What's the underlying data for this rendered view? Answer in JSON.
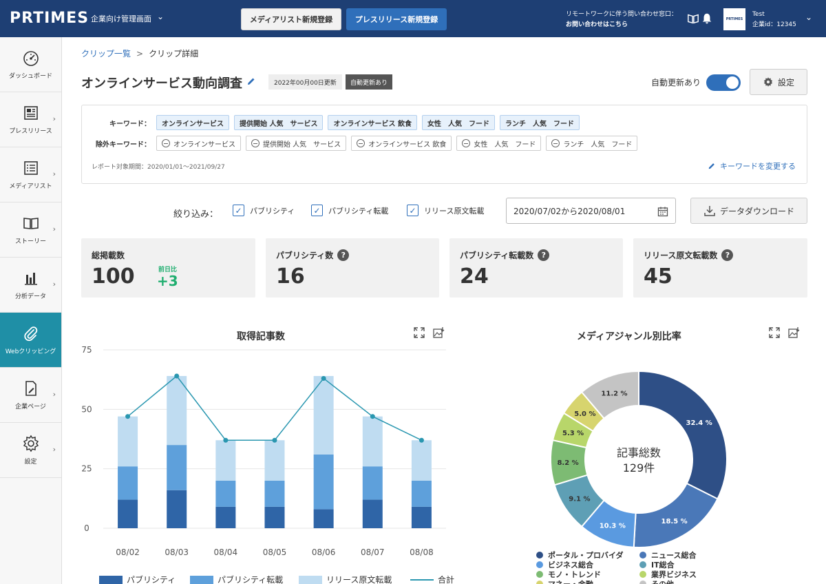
{
  "topbar": {
    "logo": "PRTIMES",
    "subtitle": "企業向け管理画面",
    "media_btn": "メディアリスト新規登録",
    "press_btn": "プレスリリース新規登録",
    "remote_line1": "リモートワークに伴う問い合わせ窓口：",
    "remote_line2": "お問い合わせはこちら",
    "avatar_text": "PRTIMES",
    "user_name": "Test",
    "user_id": "企業id：12345"
  },
  "sidebar": {
    "items": [
      {
        "label": "ダッシュボード",
        "icon": "gauge-icon"
      },
      {
        "label": "プレスリリース",
        "icon": "newspaper-icon"
      },
      {
        "label": "メディアリスト",
        "icon": "list-icon"
      },
      {
        "label": "ストーリー",
        "icon": "book-icon"
      },
      {
        "label": "分析データ",
        "icon": "bar-chart-icon"
      },
      {
        "label": "Webクリッピング",
        "icon": "paperclip-icon"
      },
      {
        "label": "企業ページ",
        "icon": "edit-page-icon"
      },
      {
        "label": "設定",
        "icon": "gear-icon"
      }
    ]
  },
  "breadcrumb": {
    "parent": "クリップ一覧",
    "sep": ">",
    "current": "クリップ詳細"
  },
  "header": {
    "title": "オンラインサービス動向調査",
    "updated": "2022年00月00日更新",
    "auto_badge": "自動更新あり",
    "auto_label": "自動更新あり",
    "settings_btn": "設定"
  },
  "keywords": {
    "include_label": "キーワード：",
    "include": [
      "オンラインサービス",
      "提供開始 人気　サービス",
      "オンラインサービス 飲食",
      "女性　人気　フード",
      "ランチ　人気　フード"
    ],
    "exclude_label": "除外キーワード：",
    "exclude": [
      "オンラインサービス",
      "提供開始 人気　サービス",
      "オンラインサービス 飲食",
      "女性　人気　フード",
      "ランチ　人気　フード"
    ],
    "period": "レポート対象期間：2020/01/01～2021/09/27",
    "change_link": "キーワードを変更する"
  },
  "filter": {
    "label": "絞り込み：",
    "options": [
      "パブリシティ",
      "パブリシティ転載",
      "リリース原文転載"
    ],
    "date_range": "2020/07/02から2020/08/01",
    "download_btn": "データダウンロード"
  },
  "stats": [
    {
      "label": "総掲載数",
      "value": "100",
      "diff_label": "前日比",
      "diff_value": "+3"
    },
    {
      "label": "パブリシティ数",
      "value": "16",
      "help": "?"
    },
    {
      "label": "パブリシティ転載数",
      "value": "24",
      "help": "?"
    },
    {
      "label": "リリース原文転載数",
      "value": "45",
      "help": "?"
    }
  ],
  "colors": {
    "brand": "#1e3f74",
    "accent": "#2f6fba",
    "active_nav": "#1f8fa6",
    "positive": "#1fae6f"
  },
  "chart_data": [
    {
      "type": "bar",
      "title": "取得記事数",
      "categories": [
        "08/02",
        "08/03",
        "08/04",
        "08/05",
        "08/06",
        "08/07",
        "08/08"
      ],
      "ylim": [
        0,
        75
      ],
      "yticks": [
        0,
        25,
        50,
        75
      ],
      "stacked": true,
      "series": [
        {
          "name": "パブリシティ",
          "color": "#2f65a7",
          "values": [
            12,
            16,
            9,
            9,
            8,
            12,
            9
          ]
        },
        {
          "name": "パブリシティ転載",
          "color": "#5ea0db",
          "values": [
            14,
            19,
            11,
            11,
            23,
            14,
            11
          ]
        },
        {
          "name": "リリース原文転載",
          "color": "#bfdcf1",
          "values": [
            21,
            29,
            17,
            17,
            33,
            21,
            17
          ]
        }
      ],
      "line": {
        "name": "合計",
        "color": "#2a97b0",
        "values": [
          47,
          64,
          37,
          37,
          63,
          47,
          37
        ]
      },
      "grid": true,
      "legend": "bottom"
    },
    {
      "type": "pie",
      "title": "メディアジャンル別比率",
      "center_label": "記事総数",
      "center_value": "129件",
      "slices": [
        {
          "label": "ポータル・プロバイダ",
          "value": 32.4,
          "text": "32.4 %",
          "color": "#2e4f86"
        },
        {
          "label": "ニュース総合",
          "value": 18.5,
          "text": "18.5 %",
          "color": "#4a78b8"
        },
        {
          "label": "ビジネス総合",
          "value": 10.3,
          "text": "10.3 %",
          "color": "#5a9ae0"
        },
        {
          "label": "IT総合",
          "value": 9.1,
          "text": "9.1 %",
          "color": "#5e9fb5"
        },
        {
          "label": "モノ・トレンド",
          "value": 8.2,
          "text": "8.2 %",
          "color": "#7dbb73"
        },
        {
          "label": "業界ビジネス",
          "value": 5.3,
          "text": "5.3 %",
          "color": "#b8d66a"
        },
        {
          "label": "マネー・金融",
          "value": 5.0,
          "text": "5.0 %",
          "color": "#d7d46e"
        },
        {
          "label": "その他",
          "value": 11.2,
          "text": "11.2 %",
          "color": "#c4c4c4"
        }
      ],
      "legend": "bottom"
    }
  ]
}
